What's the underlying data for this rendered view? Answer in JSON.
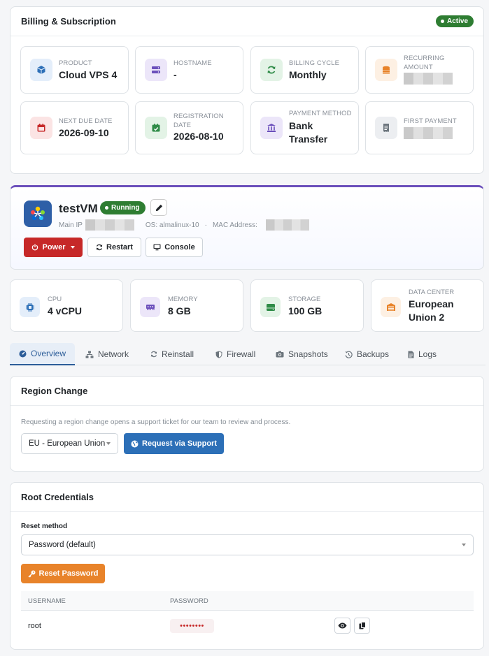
{
  "billing": {
    "title": "Billing & Subscription",
    "status": "Active",
    "tiles": [
      {
        "label": "PRODUCT",
        "value": "Cloud VPS 4",
        "icon": "cube-icon"
      },
      {
        "label": "HOSTNAME",
        "value": "-",
        "icon": "server-icon"
      },
      {
        "label": "BILLING CYCLE",
        "value": "Monthly",
        "icon": "refresh-icon"
      },
      {
        "label": "RECURRING AMOUNT",
        "value": "",
        "icon": "coins-icon"
      },
      {
        "label": "NEXT DUE DATE",
        "value": "2026-09-10",
        "icon": "calendar-icon"
      },
      {
        "label": "REGISTRATION DATE",
        "value": "2026-08-10",
        "icon": "calendar-check-icon"
      },
      {
        "label": "PAYMENT METHOD",
        "value": "Bank Transfer",
        "icon": "bank-icon"
      },
      {
        "label": "FIRST PAYMENT",
        "value": "",
        "icon": "receipt-icon"
      }
    ]
  },
  "vm": {
    "name": "testVM",
    "status": "Running",
    "main_ip_label": "Main IP",
    "os_label": "OS: almalinux-10",
    "mac_label": "MAC Address:",
    "buttons": {
      "power": "Power",
      "restart": "Restart",
      "console": "Console"
    }
  },
  "stats": [
    {
      "label": "CPU",
      "value": "4 vCPU",
      "icon": "cpu-icon"
    },
    {
      "label": "MEMORY",
      "value": "8 GB",
      "icon": "memory-icon"
    },
    {
      "label": "STORAGE",
      "value": "100 GB",
      "icon": "storage-icon"
    },
    {
      "label": "DATA CENTER",
      "value": "European Union 2",
      "icon": "datacenter-icon"
    }
  ],
  "tabs": [
    {
      "label": "Overview",
      "icon": "dashboard-icon"
    },
    {
      "label": "Network",
      "icon": "network-icon"
    },
    {
      "label": "Reinstall",
      "icon": "reinstall-icon"
    },
    {
      "label": "Firewall",
      "icon": "shield-icon"
    },
    {
      "label": "Snapshots",
      "icon": "camera-icon"
    },
    {
      "label": "Backups",
      "icon": "history-icon"
    },
    {
      "label": "Logs",
      "icon": "file-icon"
    }
  ],
  "region": {
    "title": "Region Change",
    "help": "Requesting a region change opens a support ticket for our team to review and process.",
    "selected": "EU - European Union",
    "button": "Request via Support"
  },
  "creds": {
    "title": "Root Credentials",
    "reset_label": "Reset method",
    "reset_selected": "Password (default)",
    "reset_button": "Reset Password",
    "columns": [
      "USERNAME",
      "PASSWORD"
    ],
    "username": "root",
    "password_mask": "••••••••"
  },
  "colors": {
    "active_green": "#2e7d32",
    "power_red": "#c62828",
    "primary_blue": "#2c6fb7",
    "reset_orange": "#e8832a",
    "accent_purple": "#6b4fbb"
  }
}
